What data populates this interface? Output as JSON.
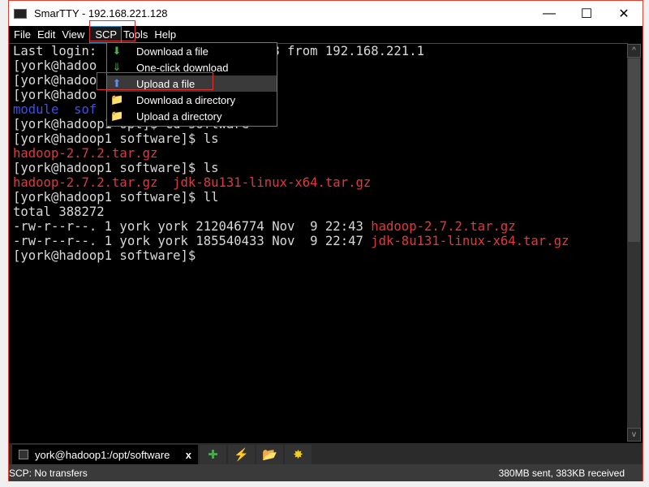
{
  "window": {
    "title": "SmarTTY - 192.168.221.128",
    "minimize": "—",
    "maximize": "☐",
    "close": "✕"
  },
  "menubar": [
    "File",
    "Edit",
    "View",
    "SCP",
    "Tools",
    "Help"
  ],
  "scp_menu": [
    {
      "label": "Download a file",
      "icon": "arrow-down-green-icon",
      "glyph": "⬇",
      "color": "#4caf50"
    },
    {
      "label": "One-click download",
      "icon": "double-arrow-down-green-icon",
      "glyph": "⇓",
      "color": "#4caf50"
    },
    {
      "label": "Upload a file",
      "icon": "arrow-up-blue-icon",
      "glyph": "⬆",
      "color": "#5b8fe8",
      "highlighted": true
    },
    {
      "label": "Download a directory",
      "icon": "folder-download-icon",
      "glyph": "📁",
      "color": "#e8c040"
    },
    {
      "label": "Upload a directory",
      "icon": "folder-upload-icon",
      "glyph": "📁",
      "color": "#e8c040"
    }
  ],
  "terminal": [
    {
      "text": "Last login:                     018 from 192.168.221.1",
      "cls": ""
    },
    {
      "text": "[york@hadoo",
      "cls": ""
    },
    {
      "text": "[york@hadoo",
      "cls": ""
    },
    {
      "text": "[york@hadoo",
      "cls": ""
    },
    {
      "text": "module  sof",
      "cls": "blue"
    },
    {
      "text": "[york@hadoop1 opt]$ cd software",
      "cls": ""
    },
    {
      "text": "[york@hadoop1 software]$ ls",
      "cls": ""
    },
    {
      "text": "hadoop-2.7.2.tar.gz",
      "cls": "red"
    },
    {
      "text": "[york@hadoop1 software]$ ls",
      "cls": ""
    },
    {
      "text": "hadoop-2.7.2.tar.gz  jdk-8u131-linux-x64.tar.gz",
      "cls": "red"
    },
    {
      "text": "[york@hadoop1 software]$ ll",
      "cls": ""
    },
    {
      "text": "total 388272",
      "cls": ""
    },
    {
      "text": "-rw-r--r--. 1 york york 212046774 Nov  9 22:43 ",
      "file": "hadoop-2.7.2.tar.gz"
    },
    {
      "text": "-rw-r--r--. 1 york york 185540433 Nov  9 22:47 ",
      "file": "jdk-8u131-linux-x64.tar.gz"
    },
    {
      "text": "[york@hadoop1 software]$",
      "cls": ""
    }
  ],
  "tabs": [
    {
      "label": "york@hadoop1:/opt/software",
      "close": "x"
    }
  ],
  "toolbar": [
    {
      "name": "new-session-icon",
      "glyph": "✚",
      "color": "#3cb043"
    },
    {
      "name": "lightning-icon",
      "glyph": "⚡",
      "color": "#e0a040"
    },
    {
      "name": "open-folder-icon",
      "glyph": "📂",
      "color": "#e8c040"
    },
    {
      "name": "sun-icon",
      "glyph": "✸",
      "color": "#f0d020"
    }
  ],
  "status": {
    "left": "SCP: No transfers",
    "right": "380MB sent, 383KB received"
  },
  "colors": {
    "accent_border": "#e04030",
    "file_red": "#e0393e",
    "dir_blue": "#3f4fe8"
  }
}
